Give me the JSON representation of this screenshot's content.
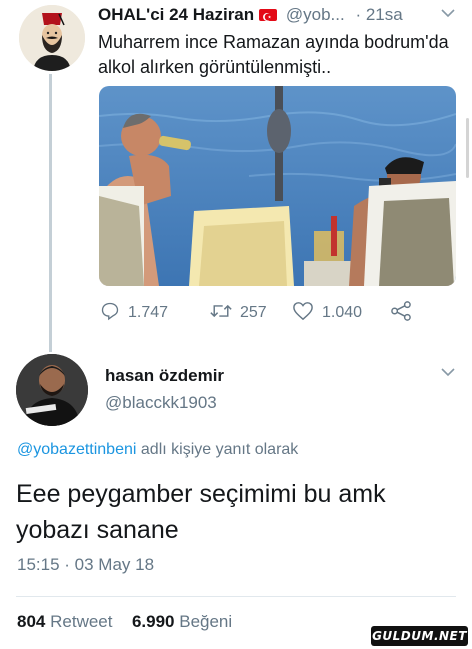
{
  "tweet1": {
    "display_name": "OHAL'ci 24 Haziran",
    "handle": "@yob...",
    "time": "· 21sa",
    "text": "Muharrem ince Ramazan ayında bodrum'da alkol alırken görüntülenmişti..",
    "actions": {
      "replies": "1.747",
      "retweets": "257",
      "likes": "1.040"
    }
  },
  "tweet2": {
    "display_name": "hasan özdemir",
    "handle": "@blacckk1903",
    "reply_mention": "@yobazettinbeni",
    "reply_suffix": "adlı kişiye yanıt olarak",
    "text": "Eee peygamber seçimimi bu amk yobazı sanane",
    "timestamp": "15:15 · 03 May 18",
    "retweet_count": "804",
    "retweet_label": "Retweet",
    "like_count": "6.990",
    "like_label": "Beğeni"
  },
  "watermark": "GULDUM.NET",
  "colors": {
    "secondary_text": "#657786",
    "link": "#1b95e0",
    "thread_line": "#c4cfd6"
  },
  "icons": [
    "reply-icon",
    "retweet-icon",
    "like-icon",
    "share-icon",
    "chevron-down-icon",
    "turkish-flag-icon"
  ]
}
